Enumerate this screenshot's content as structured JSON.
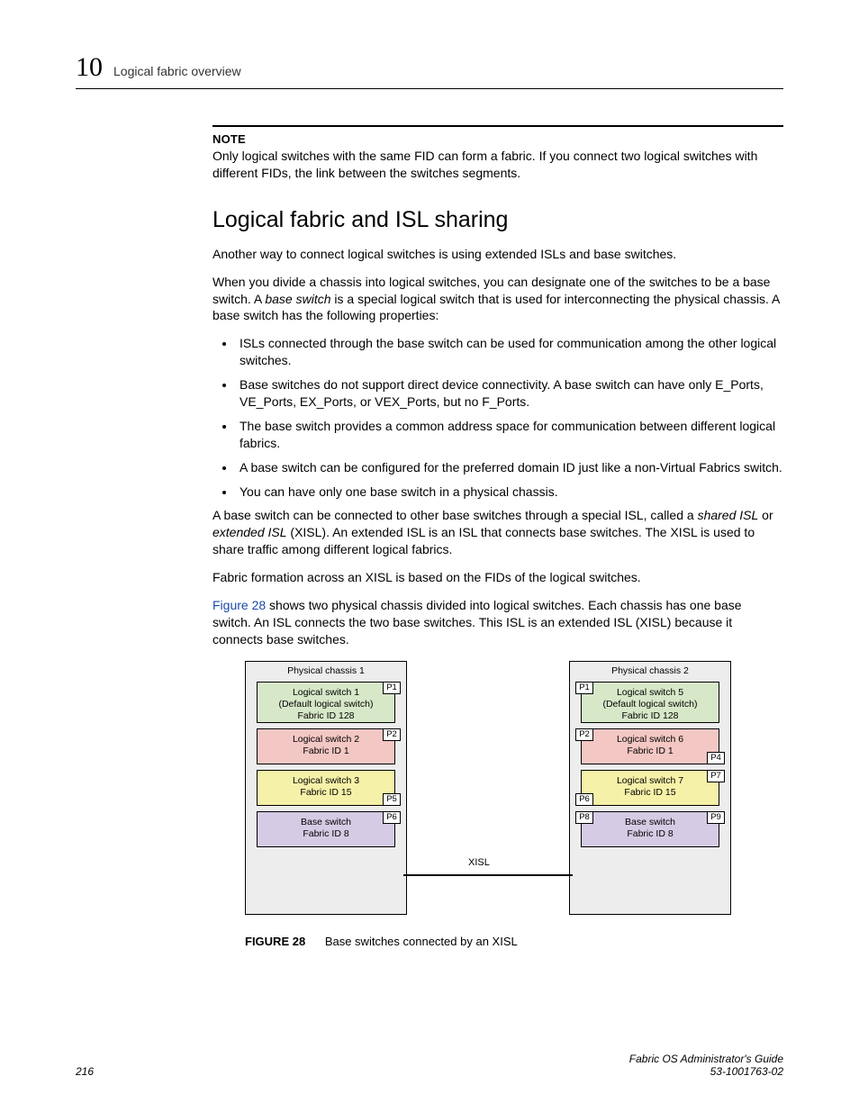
{
  "header": {
    "chapter_number": "10",
    "title": "Logical fabric overview"
  },
  "note": {
    "label": "NOTE",
    "text": "Only logical switches with the same FID can form a fabric. If you connect two logical switches with different FIDs, the link between the switches segments."
  },
  "section_heading": "Logical fabric and ISL sharing",
  "p1": "Another way to connect logical switches is using extended ISLs and base switches.",
  "p2a": "When you divide a chassis into logical switches, you can designate one of the switches to be a base switch. A ",
  "p2_ital": "base switch",
  "p2b": " is a special logical switch that is used for interconnecting the physical chassis. A base switch has the following properties:",
  "bullets": [
    "ISLs connected through the base switch can be used for communication among the other logical switches.",
    "Base switches do not support direct device connectivity. A base switch can have only E_Ports, VE_Ports, EX_Ports, or VEX_Ports, but no F_Ports.",
    "The base switch provides a common address space for communication between different logical fabrics.",
    "A base switch can be configured for the preferred domain ID just like a non-Virtual Fabrics switch.",
    "You can have only one base switch in a physical chassis."
  ],
  "p3a": "A base switch can be connected to other base switches through a special ISL, called a ",
  "p3_ital1": "shared ISL",
  "p3b": " or ",
  "p3_ital2": "extended ISL",
  "p3c": " (XISL). An extended ISL is an ISL that connects base switches. The XISL is used to share traffic among different logical fabrics.",
  "p4": "Fabric formation across an XISL is based on the FIDs of the logical switches.",
  "p5_link": "Figure 28",
  "p5_rest": " shows two physical chassis divided into logical switches. Each chassis has one base switch. An ISL connects the two base switches. This ISL is an extended ISL (XISL) because it connects base switches.",
  "figure": {
    "number_label": "FIGURE 28",
    "caption": "Base switches connected by an XISL",
    "xisl_label": "XISL",
    "chassis1": {
      "title": "Physical chassis 1",
      "boxes": [
        {
          "l1": "Logical switch 1",
          "l2": "(Default logical switch)",
          "l3": "Fabric ID 128"
        },
        {
          "l1": "Logical switch 2",
          "l2": "Fabric ID 1"
        },
        {
          "l1": "Logical switch 3",
          "l2": "Fabric ID 15"
        },
        {
          "l1": "Base switch",
          "l2": "Fabric ID 8"
        }
      ],
      "ports": {
        "p1": "P1",
        "p2": "P2",
        "p5": "P5",
        "p6": "P6"
      }
    },
    "chassis2": {
      "title": "Physical chassis 2",
      "boxes": [
        {
          "l1": "Logical switch 5",
          "l2": "(Default logical switch)",
          "l3": "Fabric ID 128"
        },
        {
          "l1": "Logical switch 6",
          "l2": "Fabric ID 1"
        },
        {
          "l1": "Logical switch 7",
          "l2": "Fabric ID 15"
        },
        {
          "l1": "Base switch",
          "l2": "Fabric ID 8"
        }
      ],
      "ports": {
        "p1": "P1",
        "p2": "P2",
        "p4": "P4",
        "p6": "P6",
        "p7": "P7",
        "p8": "P8",
        "p9": "P9"
      }
    }
  },
  "footer": {
    "page": "216",
    "doc_title": "Fabric OS Administrator's Guide",
    "doc_num": "53-1001763-02"
  }
}
